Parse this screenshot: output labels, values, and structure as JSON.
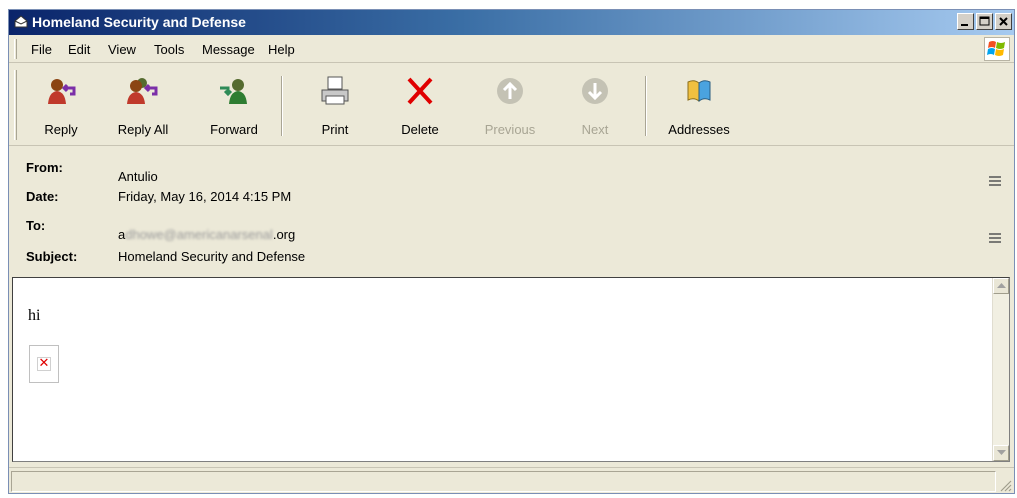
{
  "window": {
    "title": "Homeland Security and Defense",
    "controls": [
      "minimize",
      "maximize",
      "close"
    ]
  },
  "menu": {
    "items": [
      "File",
      "Edit",
      "View",
      "Tools",
      "Message",
      "Help"
    ]
  },
  "toolbar": {
    "buttons": [
      {
        "label": "Reply",
        "icon": "reply-icon",
        "enabled": true
      },
      {
        "label": "Reply All",
        "icon": "reply-all-icon",
        "enabled": true
      },
      {
        "label": "Forward",
        "icon": "forward-icon",
        "enabled": true
      },
      {
        "label": "Print",
        "icon": "print-icon",
        "enabled": true
      },
      {
        "label": "Delete",
        "icon": "delete-icon",
        "enabled": true
      },
      {
        "label": "Previous",
        "icon": "previous-icon",
        "enabled": false
      },
      {
        "label": "Next",
        "icon": "next-icon",
        "enabled": false
      },
      {
        "label": "Addresses",
        "icon": "addresses-icon",
        "enabled": true
      }
    ]
  },
  "header": {
    "from_label": "From:",
    "from_value": "Antulio",
    "date_label": "Date:",
    "date_value": "Friday, May 16, 2014 4:15 PM",
    "to_label": "To:",
    "to_prefix": "a",
    "to_blurred": "dhowe@americanarsenal",
    "to_suffix": ".org",
    "subject_label": "Subject:",
    "subject_value": "Homeland Security and Defense"
  },
  "message": {
    "body_text": "hi",
    "broken_image_glyph": "✕"
  },
  "colors": {
    "titlebar_start": "#0a246a",
    "chrome": "#ece9d8",
    "delete_red": "#e00000"
  }
}
